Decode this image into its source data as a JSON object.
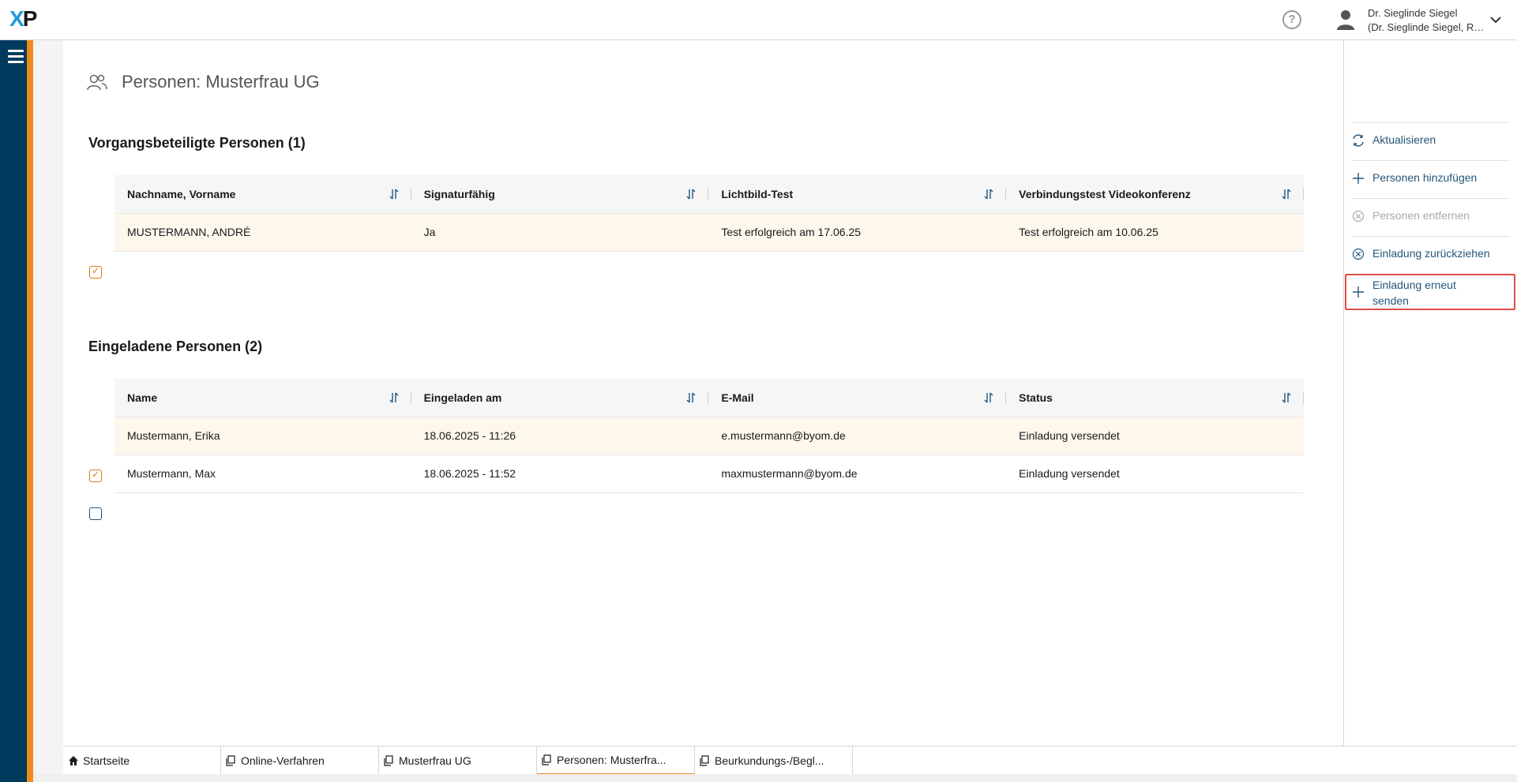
{
  "header": {
    "logo_text_1": "X",
    "logo_text_2": "P",
    "help_glyph": "?",
    "user_name": "Dr. Sieglinde Siegel",
    "user_subtitle": "(Dr. Sieglinde Siegel, Re..."
  },
  "page": {
    "title": "Personen: Musterfrau UG"
  },
  "participants": {
    "title": "Vorgangsbeteiligte Personen (1)",
    "columns": [
      "Nachname, Vorname",
      "Signaturfähig",
      "Lichtbild-Test",
      "Verbindungstest Videokonferenz"
    ],
    "rows": [
      {
        "cells": [
          "MUSTERMANN, ANDRÉ",
          "Ja",
          "Test erfolgreich am 17.06.25",
          "Test erfolgreich am 10.06.25"
        ],
        "checked": true
      }
    ]
  },
  "invited": {
    "title": "Eingeladene Personen (2)",
    "columns": [
      "Name",
      "Eingeladen am",
      "E-Mail",
      "Status"
    ],
    "rows": [
      {
        "cells": [
          "Mustermann, Erika",
          "18.06.2025 - 11:26",
          "e.mustermann@byom.de",
          "Einladung versendet"
        ],
        "checked": true
      },
      {
        "cells": [
          "Mustermann, Max",
          "18.06.2025 - 11:52",
          "maxmustermann@byom.de",
          "Einladung versendet"
        ],
        "checked": false
      }
    ]
  },
  "actions": [
    {
      "label": "Aktualisieren",
      "icon": "refresh-icon",
      "disabled": false
    },
    {
      "label": "Personen hinzufügen",
      "icon": "plus-icon",
      "disabled": false
    },
    {
      "label": "Personen entfernen",
      "icon": "circle-x-icon",
      "disabled": true
    },
    {
      "label": "Einladung zurückziehen",
      "icon": "circle-x-icon",
      "disabled": false
    },
    {
      "label": "Einladung erneut senden",
      "icon": "plus-icon",
      "disabled": false
    }
  ],
  "tabs": [
    {
      "label": "Startseite",
      "icon": "home-icon",
      "active": false
    },
    {
      "label": "Online-Verfahren",
      "icon": "document-icon",
      "active": false
    },
    {
      "label": "Musterfrau UG",
      "icon": "document-icon",
      "active": false
    },
    {
      "label": "Personen: Musterfra...",
      "icon": "document-icon",
      "active": true
    },
    {
      "label": "Beurkundungs-/Begl...",
      "icon": "document-icon",
      "active": false
    }
  ],
  "colors": {
    "nav_blue": "#003a5d",
    "accent_orange": "#f08a1c",
    "link_blue": "#24557a",
    "selected_row": "#fdf7ec",
    "highlight_red": "#e04c4c"
  }
}
